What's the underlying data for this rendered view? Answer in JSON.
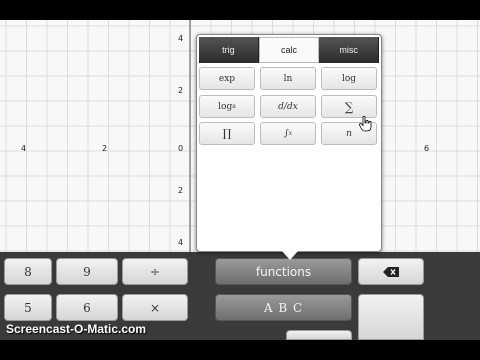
{
  "graph": {
    "x_ticks": [
      "4",
      "2",
      "0",
      "6"
    ],
    "y_ticks_top": [
      "4",
      "2"
    ],
    "y_ticks_bottom": [
      "2",
      "4"
    ]
  },
  "popup": {
    "tabs": [
      "trig",
      "calc",
      "misc"
    ],
    "active_tab": "calc",
    "row1": [
      "exp",
      "ln",
      "log"
    ],
    "row2": [
      "log",
      "d/dx",
      "∑"
    ],
    "row2_sub": "a",
    "row3": [
      "∏",
      "∫",
      "n"
    ],
    "row3_int_sup": "x"
  },
  "keyboard": {
    "row1": [
      "8",
      "9",
      "÷"
    ],
    "row2": [
      "5",
      "6",
      "×"
    ],
    "functions_label": "functions",
    "abc_label": "A B C",
    "backspace_icon": "backspace-icon"
  },
  "watermark": "Screencast-O-Matic.com"
}
